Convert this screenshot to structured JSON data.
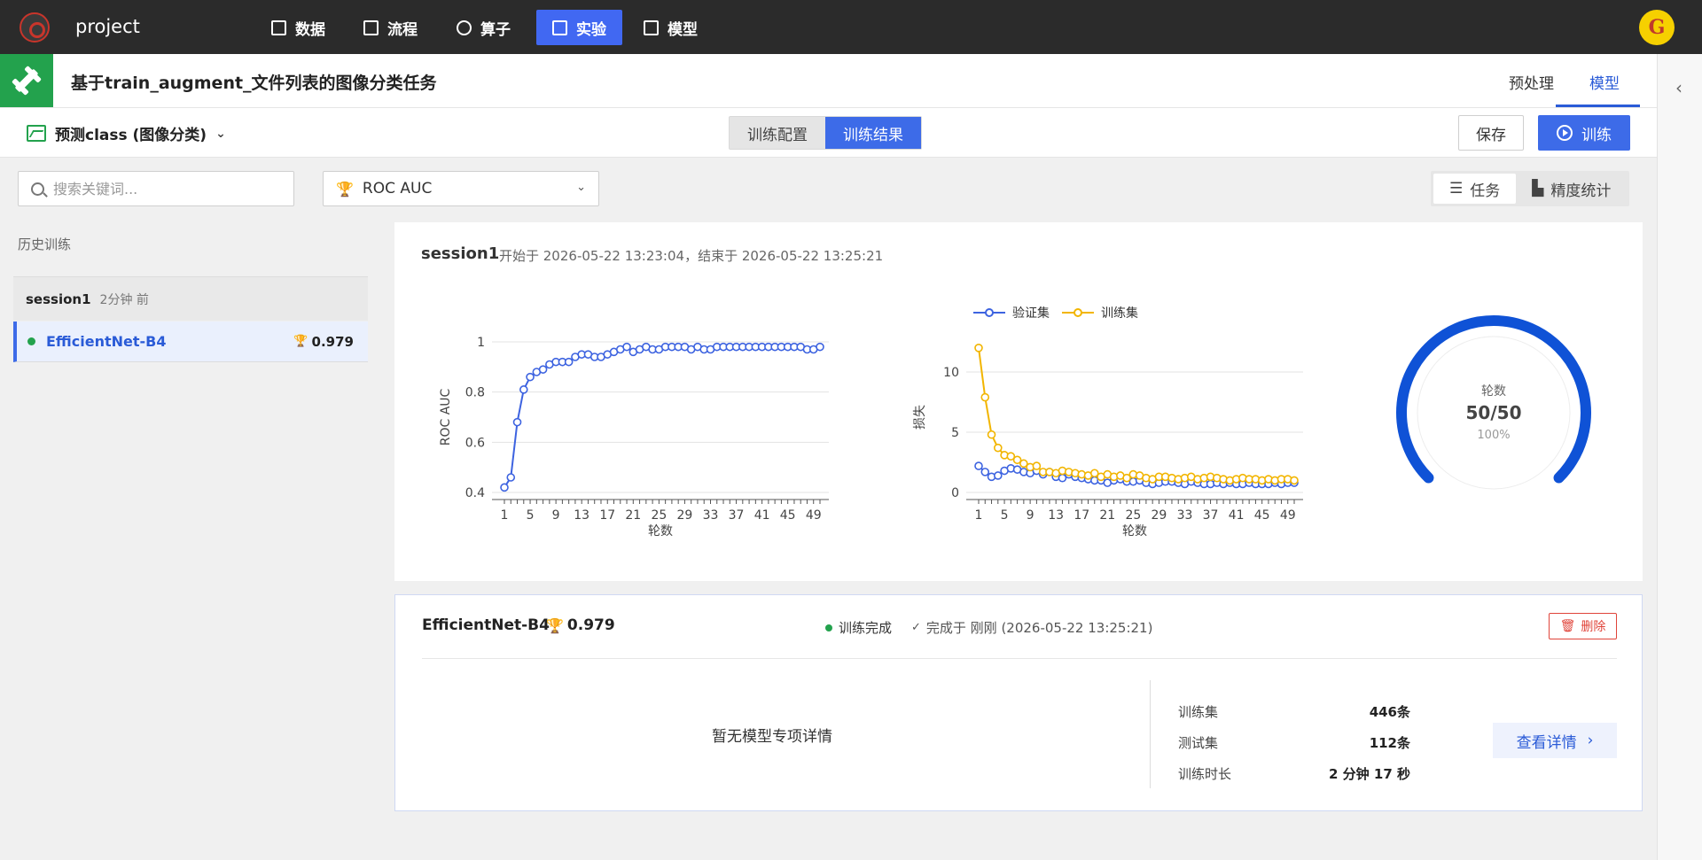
{
  "nav": {
    "project": "project",
    "items": [
      {
        "label": "数据",
        "icon": "table-icon"
      },
      {
        "label": "流程",
        "icon": "flow-icon"
      },
      {
        "label": "算子",
        "icon": "hexagon-icon"
      },
      {
        "label": "实验",
        "icon": "cube-icon"
      },
      {
        "label": "模型",
        "icon": "save-icon"
      }
    ],
    "active": "实验",
    "avatar": "G",
    "accent": "#4168f2"
  },
  "header": {
    "title": "基于train_augment_文件列表的图像分类任务",
    "tabs": [
      {
        "label": "预处理"
      },
      {
        "label": "模型"
      }
    ],
    "active_tab": "模型"
  },
  "toolbar": {
    "model_select": "预测class (图像分类)",
    "segments": [
      {
        "label": "训练配置"
      },
      {
        "label": "训练结果"
      }
    ],
    "active_segment": "训练结果",
    "save": "保存",
    "train": "训练"
  },
  "filters": {
    "search_placeholder": "搜索关键词...",
    "metric": "ROC AUC",
    "views": [
      {
        "label": "任务"
      },
      {
        "label": "精度统计"
      }
    ]
  },
  "sidebar": {
    "history_label": "历史训练",
    "session": {
      "name": "session1",
      "ago": "2分钟 前"
    },
    "item": {
      "name": "EfficientNet-B4",
      "score": "0.979"
    }
  },
  "session_card": {
    "title": "session1",
    "time": "开始于  2026-05-22 13:23:04，结束于  2026-05-22 13:25:21",
    "gauge": {
      "label": "轮数",
      "value": "50/50",
      "percent": "100%",
      "fraction": 1.0,
      "color": "#0f52d6"
    }
  },
  "chart_data": [
    {
      "type": "line",
      "xlabel": "轮数",
      "ylabel": "ROC AUC",
      "ylim": [
        0.4,
        1.0
      ],
      "xlim": [
        1,
        50
      ],
      "yticks": [
        0.4,
        0.6,
        0.8,
        1
      ],
      "xticks": [
        1,
        5,
        9,
        13,
        17,
        21,
        25,
        29,
        33,
        37,
        41,
        45,
        49
      ],
      "grid": true,
      "series": [
        {
          "color": "#3d63e0",
          "x": [
            1,
            2,
            3,
            4,
            5,
            6,
            7,
            8,
            9,
            10,
            11,
            12,
            13,
            14,
            15,
            16,
            17,
            18,
            19,
            20,
            21,
            22,
            23,
            24,
            25,
            26,
            27,
            28,
            29,
            30,
            31,
            32,
            33,
            34,
            35,
            36,
            37,
            38,
            39,
            40,
            41,
            42,
            43,
            44,
            45,
            46,
            47,
            48,
            49,
            50
          ],
          "y": [
            0.42,
            0.46,
            0.68,
            0.81,
            0.86,
            0.88,
            0.89,
            0.91,
            0.92,
            0.92,
            0.92,
            0.94,
            0.95,
            0.95,
            0.94,
            0.94,
            0.95,
            0.96,
            0.97,
            0.98,
            0.96,
            0.97,
            0.98,
            0.97,
            0.97,
            0.98,
            0.98,
            0.98,
            0.98,
            0.97,
            0.98,
            0.97,
            0.97,
            0.98,
            0.98,
            0.98,
            0.98,
            0.98,
            0.98,
            0.98,
            0.98,
            0.98,
            0.98,
            0.98,
            0.98,
            0.98,
            0.98,
            0.97,
            0.97,
            0.98
          ]
        }
      ]
    },
    {
      "type": "line",
      "xlabel": "轮数",
      "ylabel": "损失",
      "ylim": [
        0,
        12.5
      ],
      "xlim": [
        1,
        50
      ],
      "yticks": [
        0,
        5,
        10
      ],
      "xticks": [
        1,
        5,
        9,
        13,
        17,
        21,
        25,
        29,
        33,
        37,
        41,
        45,
        49
      ],
      "grid": true,
      "legend": "top-left",
      "series": [
        {
          "name": "验证集",
          "color": "#3d63e0",
          "x": [
            1,
            2,
            3,
            4,
            5,
            6,
            7,
            8,
            9,
            10,
            11,
            12,
            13,
            14,
            15,
            16,
            17,
            18,
            19,
            20,
            21,
            22,
            23,
            24,
            25,
            26,
            27,
            28,
            29,
            30,
            31,
            32,
            33,
            34,
            35,
            36,
            37,
            38,
            39,
            40,
            41,
            42,
            43,
            44,
            45,
            46,
            47,
            48,
            49,
            50
          ],
          "y": [
            2.2,
            1.7,
            1.3,
            1.4,
            1.8,
            2.0,
            1.9,
            1.7,
            1.6,
            1.8,
            1.5,
            1.7,
            1.3,
            1.2,
            1.5,
            1.3,
            1.2,
            1.1,
            1.0,
            1.0,
            0.8,
            1.0,
            1.1,
            0.9,
            0.9,
            1.0,
            0.8,
            0.7,
            0.8,
            0.9,
            0.9,
            0.8,
            0.7,
            0.9,
            0.8,
            0.7,
            0.7,
            0.8,
            0.7,
            0.8,
            0.7,
            0.7,
            0.8,
            0.7,
            0.7,
            0.7,
            0.8,
            0.7,
            0.8,
            0.8
          ]
        },
        {
          "name": "训练集",
          "color": "#f2b500",
          "x": [
            1,
            2,
            3,
            4,
            5,
            6,
            7,
            8,
            9,
            10,
            11,
            12,
            13,
            14,
            15,
            16,
            17,
            18,
            19,
            20,
            21,
            22,
            23,
            24,
            25,
            26,
            27,
            28,
            29,
            30,
            31,
            32,
            33,
            34,
            35,
            36,
            37,
            38,
            39,
            40,
            41,
            42,
            43,
            44,
            45,
            46,
            47,
            48,
            49,
            50
          ],
          "y": [
            12.0,
            7.9,
            4.8,
            3.7,
            3.1,
            3.0,
            2.7,
            2.4,
            2.1,
            2.2,
            1.7,
            1.7,
            1.6,
            1.8,
            1.7,
            1.6,
            1.5,
            1.4,
            1.6,
            1.3,
            1.5,
            1.3,
            1.4,
            1.2,
            1.5,
            1.4,
            1.2,
            1.1,
            1.3,
            1.3,
            1.2,
            1.1,
            1.2,
            1.3,
            1.1,
            1.2,
            1.3,
            1.2,
            1.1,
            1.0,
            1.1,
            1.2,
            1.1,
            1.1,
            1.0,
            1.1,
            1.0,
            1.1,
            1.1,
            1.0
          ]
        }
      ]
    }
  ],
  "detail": {
    "name": "EfficientNet-B4",
    "score": "0.979",
    "status": "训练完成",
    "done": "完成于 刚刚 (2026-05-22 13:25:21)",
    "delete": "删除",
    "empty": "暂无模型专项详情",
    "stats": [
      {
        "label": "训练集",
        "value": "446条"
      },
      {
        "label": "测试集",
        "value": "112条"
      },
      {
        "label": "训练时长",
        "value": "2 分钟 17 秒"
      }
    ],
    "view_details": "查看详情"
  }
}
